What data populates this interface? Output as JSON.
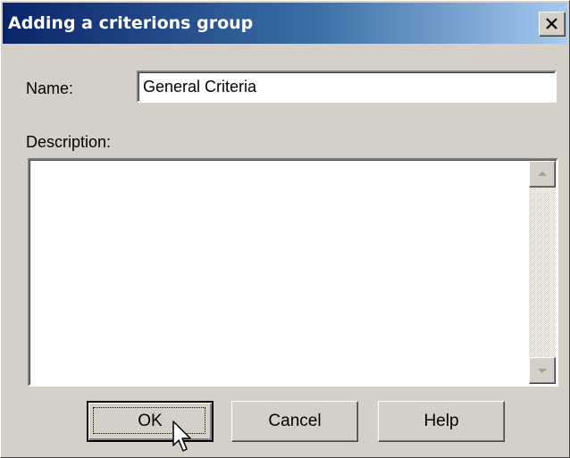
{
  "window": {
    "title": "Adding a criterions group",
    "close_icon": "close-icon"
  },
  "form": {
    "name_label": "Name:",
    "name_value": "General Criteria",
    "description_label": "Description:",
    "description_value": ""
  },
  "buttons": {
    "ok": "OK",
    "cancel": "Cancel",
    "help": "Help"
  },
  "colors": {
    "titlebar_start": "#0a246a",
    "titlebar_end": "#a6caf0",
    "dialog_face": "#d4d0c8"
  }
}
